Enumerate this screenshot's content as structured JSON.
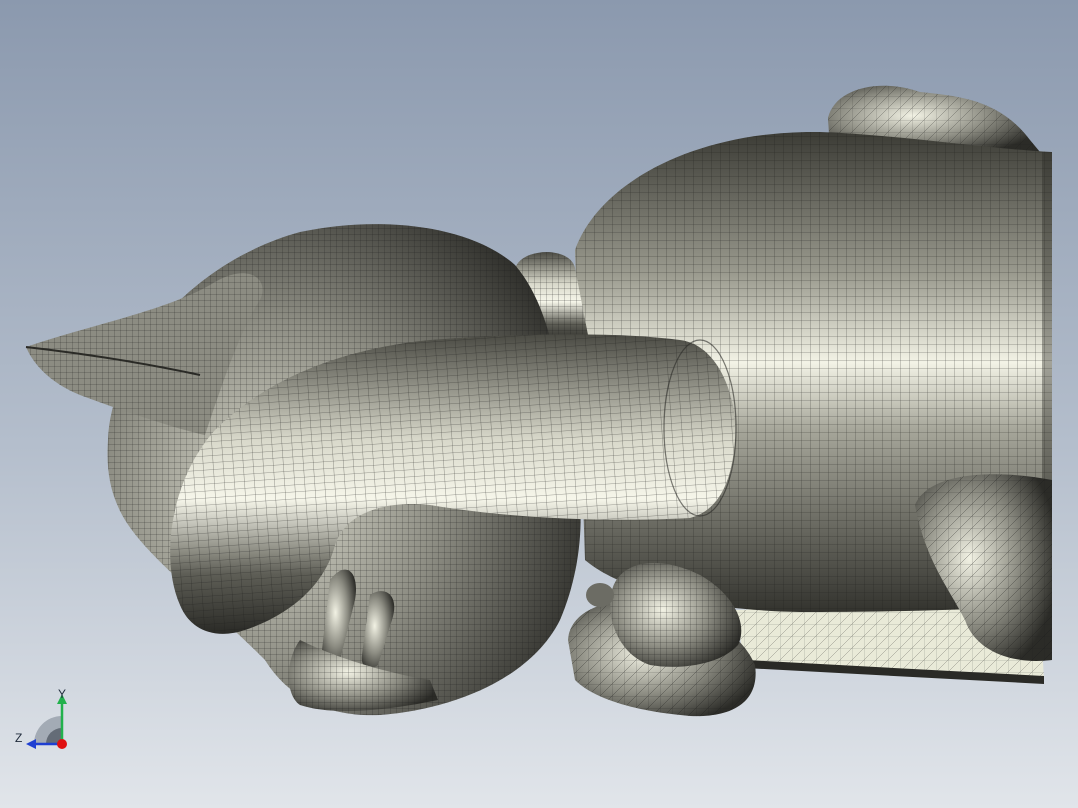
{
  "viewport": {
    "background_top": "#8d9bb0",
    "background_bottom": "#dfe3e9",
    "model_shade_dark": "#2a2a26",
    "model_shade_mid": "#8a8a80",
    "model_shade_light": "#f4f4e8",
    "mesh_line": "#1c1c1a"
  },
  "triad": {
    "y_label": "Y",
    "z_label": "Z",
    "y_color": "#22b14c",
    "z_color": "#1f3fd1",
    "x_color": "#e01010",
    "icon": "coordinate-triad-icon"
  }
}
